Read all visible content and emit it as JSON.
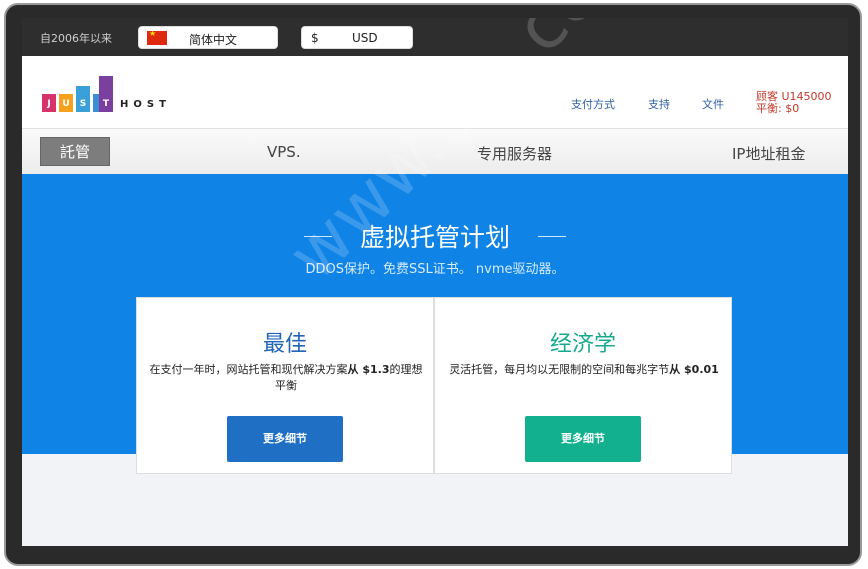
{
  "topbar": {
    "since": "自2006年以来",
    "language": "简体中文",
    "currency_symbol": "$",
    "currency": "USD"
  },
  "header": {
    "logo_letters": [
      "J",
      "U",
      "S",
      "T"
    ],
    "logo_host": "HOST",
    "links": [
      "支付方式",
      "支持",
      "文件"
    ],
    "account_line1": "顾客 U145000",
    "account_line2": "平衡: $0"
  },
  "menu": {
    "active": "託管",
    "items": [
      "VPS.",
      "专用服务器",
      "IP地址租金"
    ]
  },
  "hero": {
    "title": "虚拟托管计划",
    "subtitle": "DDOS保护。免费SSL证书。 nvme驱动器。"
  },
  "cards": [
    {
      "title": "最佳",
      "desc_prefix": "在支付一年时，网站托管和现代解决方案",
      "desc_bold": "从 $1.3",
      "desc_suffix": "的理想平衡",
      "button": "更多细节"
    },
    {
      "title": "经济学",
      "desc_prefix": "灵活托管，每月均以无限制的空间和每兆字节",
      "desc_bold": "从 $0.01",
      "desc_suffix": "",
      "button": "更多细节"
    }
  ],
  "watermark": "www.52..com",
  "colors": {
    "hero": "#0f83e6",
    "best": "#1f66b8",
    "economy": "#17a98f"
  }
}
